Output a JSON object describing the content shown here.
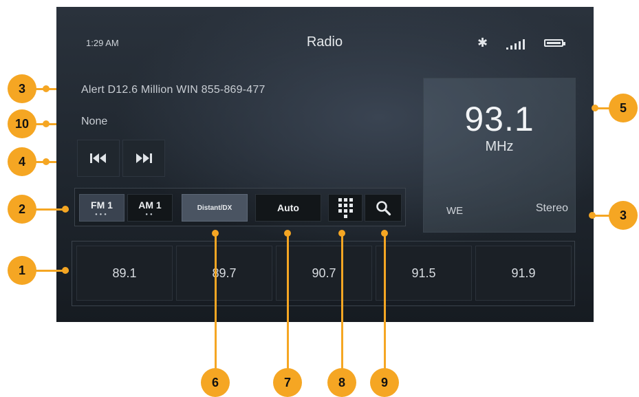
{
  "status": {
    "time": "1:29 AM",
    "title": "Radio"
  },
  "icons": {
    "bluetooth": "bluetooth-icon",
    "signal": "signal-icon",
    "battery": "battery-icon"
  },
  "now_playing": {
    "rds_text": "Alert D12.6 Million WIN 855-869-477",
    "genre": "None"
  },
  "frequency": {
    "value": "93.1",
    "unit": "MHz",
    "station": "WE",
    "mode": "Stereo"
  },
  "tuner": {
    "band_fm": "FM 1",
    "band_am": "AM 1",
    "fm_dots": "●●●",
    "am_dots": "●●",
    "distant": "Distant/DX",
    "auto": "Auto"
  },
  "presets": [
    "89.1",
    "89.7",
    "90.7",
    "91.5",
    "91.9"
  ],
  "callouts": [
    "3",
    "10",
    "4",
    "2",
    "1",
    "5",
    "3",
    "6",
    "7",
    "8",
    "9"
  ],
  "colors": {
    "callout": "#f5a623",
    "screen_bg": "#232a33"
  }
}
